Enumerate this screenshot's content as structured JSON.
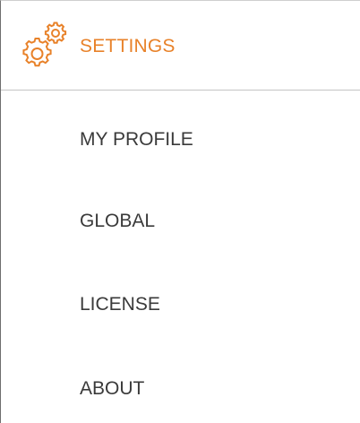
{
  "header": {
    "title": "SETTINGS",
    "icon": "gears-icon",
    "accent_color": "#e8822a"
  },
  "menu": {
    "items": [
      {
        "label": "MY PROFILE"
      },
      {
        "label": "GLOBAL"
      },
      {
        "label": "LICENSE"
      },
      {
        "label": "ABOUT"
      }
    ]
  }
}
